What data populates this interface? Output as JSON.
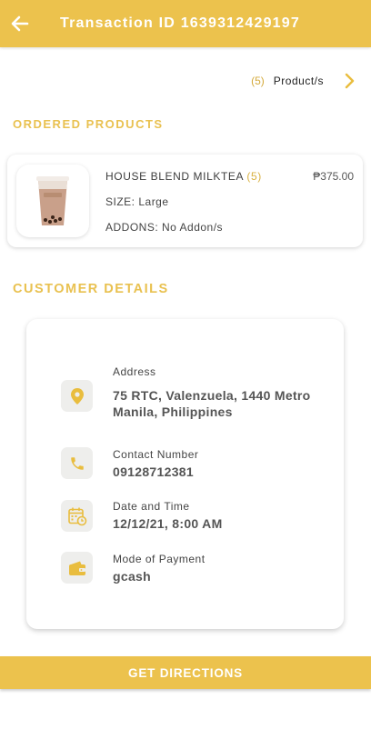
{
  "header": {
    "title": "Transaction ID 1639312429197",
    "back_icon": "arrow-left-icon"
  },
  "products_summary": {
    "count": "(5)",
    "label": "Product/s",
    "chevron_icon": "chevron-right-icon"
  },
  "ordered_section": {
    "heading": "ORDERED PRODUCTS"
  },
  "product": {
    "name": "HOUSE BLEND MILKTEA",
    "qty": "(5)",
    "price": "₱375.00",
    "size": "SIZE: Large",
    "addons": "ADDONS: No Addon/s",
    "image_icon": "milktea-cup-image"
  },
  "customer_section": {
    "heading": "CUSTOMER DETAILS"
  },
  "customer": {
    "address_label": "Address",
    "address_value": "75 RTC, Valenzuela, 1440 Metro Manila, Philippines",
    "contact_label": "Contact Number",
    "contact_value": "09128712381",
    "datetime_label": "Date and Time",
    "datetime_value": "12/12/21, 8:00 AM",
    "payment_label": "Mode of Payment",
    "payment_value": "gcash"
  },
  "action": {
    "directions_label": "GET DIRECTIONS"
  },
  "colors": {
    "accent": "#ecc24d",
    "icon_bg": "#eeeeec",
    "icon": "#e9bd3e"
  }
}
